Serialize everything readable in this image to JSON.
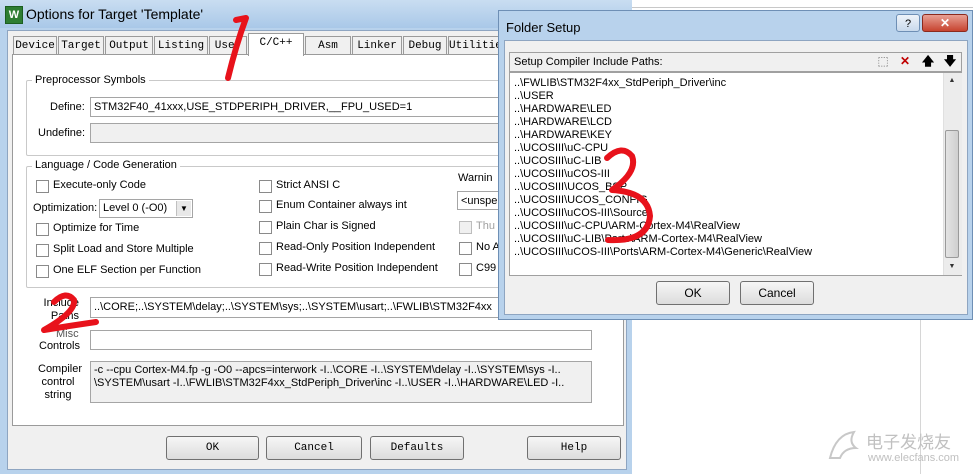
{
  "main_window": {
    "title": "Options for Target 'Template'",
    "app_icon_glyph": "W",
    "tabs": [
      {
        "label": "Device"
      },
      {
        "label": "Target"
      },
      {
        "label": "Output"
      },
      {
        "label": "Listing"
      },
      {
        "label": "User"
      },
      {
        "label": "C/C++",
        "active": true
      },
      {
        "label": "Asm"
      },
      {
        "label": "Linker"
      },
      {
        "label": "Debug"
      },
      {
        "label": "Utilities"
      }
    ],
    "preprocessor": {
      "group_label": "Preprocessor Symbols",
      "define_label": "Define:",
      "define_value": "STM32F40_41xxx,USE_STDPERIPH_DRIVER,__FPU_USED=1",
      "undefine_label": "Undefine:",
      "undefine_value": ""
    },
    "language": {
      "group_label": "Language / Code Generation",
      "execute_only": "Execute-only Code",
      "optimization_label": "Optimization:",
      "optimization_value": "Level 0 (-O0)",
      "optimize_time": "Optimize for Time",
      "split_load": "Split Load and Store Multiple",
      "one_elf": "One ELF Section per Function",
      "strict_ansi": "Strict ANSI C",
      "enum_container": "Enum Container always int",
      "plain_char": "Plain Char is Signed",
      "ro_pi": "Read-Only Position Independent",
      "rw_pi": "Read-Write Position Independent",
      "warnings_label": "Warnin",
      "warnings_value": "<unspe",
      "thumb_label": "Thu",
      "no_auto_label": "No A",
      "c99_label": "C99"
    },
    "include_paths": {
      "label": "Include Paths",
      "value": "..\\CORE;..\\SYSTEM\\delay;..\\SYSTEM\\sys;..\\SYSTEM\\usart;..\\FWLIB\\STM32F4xx"
    },
    "misc_controls": {
      "label": "Controls",
      "label_partial": "Misc",
      "value": ""
    },
    "compiler_string": {
      "label_line1": "Compiler",
      "label_line2": "control",
      "label_line3": "string",
      "line1": "-c --cpu Cortex-M4.fp -g -O0 --apcs=interwork -I..\\CORE -I..\\SYSTEM\\delay -I..\\SYSTEM\\sys -I..",
      "line2": "\\SYSTEM\\usart -I..\\FWLIB\\STM32F4xx_StdPeriph_Driver\\inc -I..\\USER -I..\\HARDWARE\\LED -I.."
    },
    "buttons": {
      "ok": "OK",
      "cancel": "Cancel",
      "defaults": "Defaults",
      "help": "Help"
    }
  },
  "folder_setup": {
    "title": "Folder Setup",
    "help_glyph": "?",
    "close_glyph": "✕",
    "list_label": "Setup Compiler Include Paths:",
    "toolbar_icons": [
      "new-folder-icon",
      "delete-icon",
      "move-up-icon",
      "move-down-icon"
    ],
    "toolbar_glyphs": [
      "⬚",
      "✕",
      "🡅",
      "🡇"
    ],
    "paths": [
      "..\\FWLIB\\STM32F4xx_StdPeriph_Driver\\inc",
      "..\\USER",
      "..\\HARDWARE\\LED",
      "..\\HARDWARE\\LCD",
      "..\\HARDWARE\\KEY",
      "..\\UCOSIII\\uC-CPU",
      "..\\UCOSIII\\uC-LIB",
      "..\\UCOSIII\\uCOS-III",
      "..\\UCOSIII\\UCOS_BSP",
      "..\\UCOSIII\\UCOS_CONFIG",
      "..\\UCOSIII\\uCOS-III\\Source",
      "..\\UCOSIII\\uC-CPU\\ARM-Cortex-M4\\RealView",
      "..\\UCOSIII\\uC-LIB\\Ports\\ARM-Cortex-M4\\RealView",
      "..\\UCOSIII\\uCOS-III\\Ports\\ARM-Cortex-M4\\Generic\\RealView"
    ],
    "ok": "OK",
    "cancel": "Cancel"
  },
  "watermark": {
    "text": "电子发烧友",
    "url": "www.elecfans.com"
  },
  "colors": {
    "annotation_red": "#e8121b",
    "title_bar": "#b8d2ec",
    "dialog_bg": "#f0f0f0"
  }
}
